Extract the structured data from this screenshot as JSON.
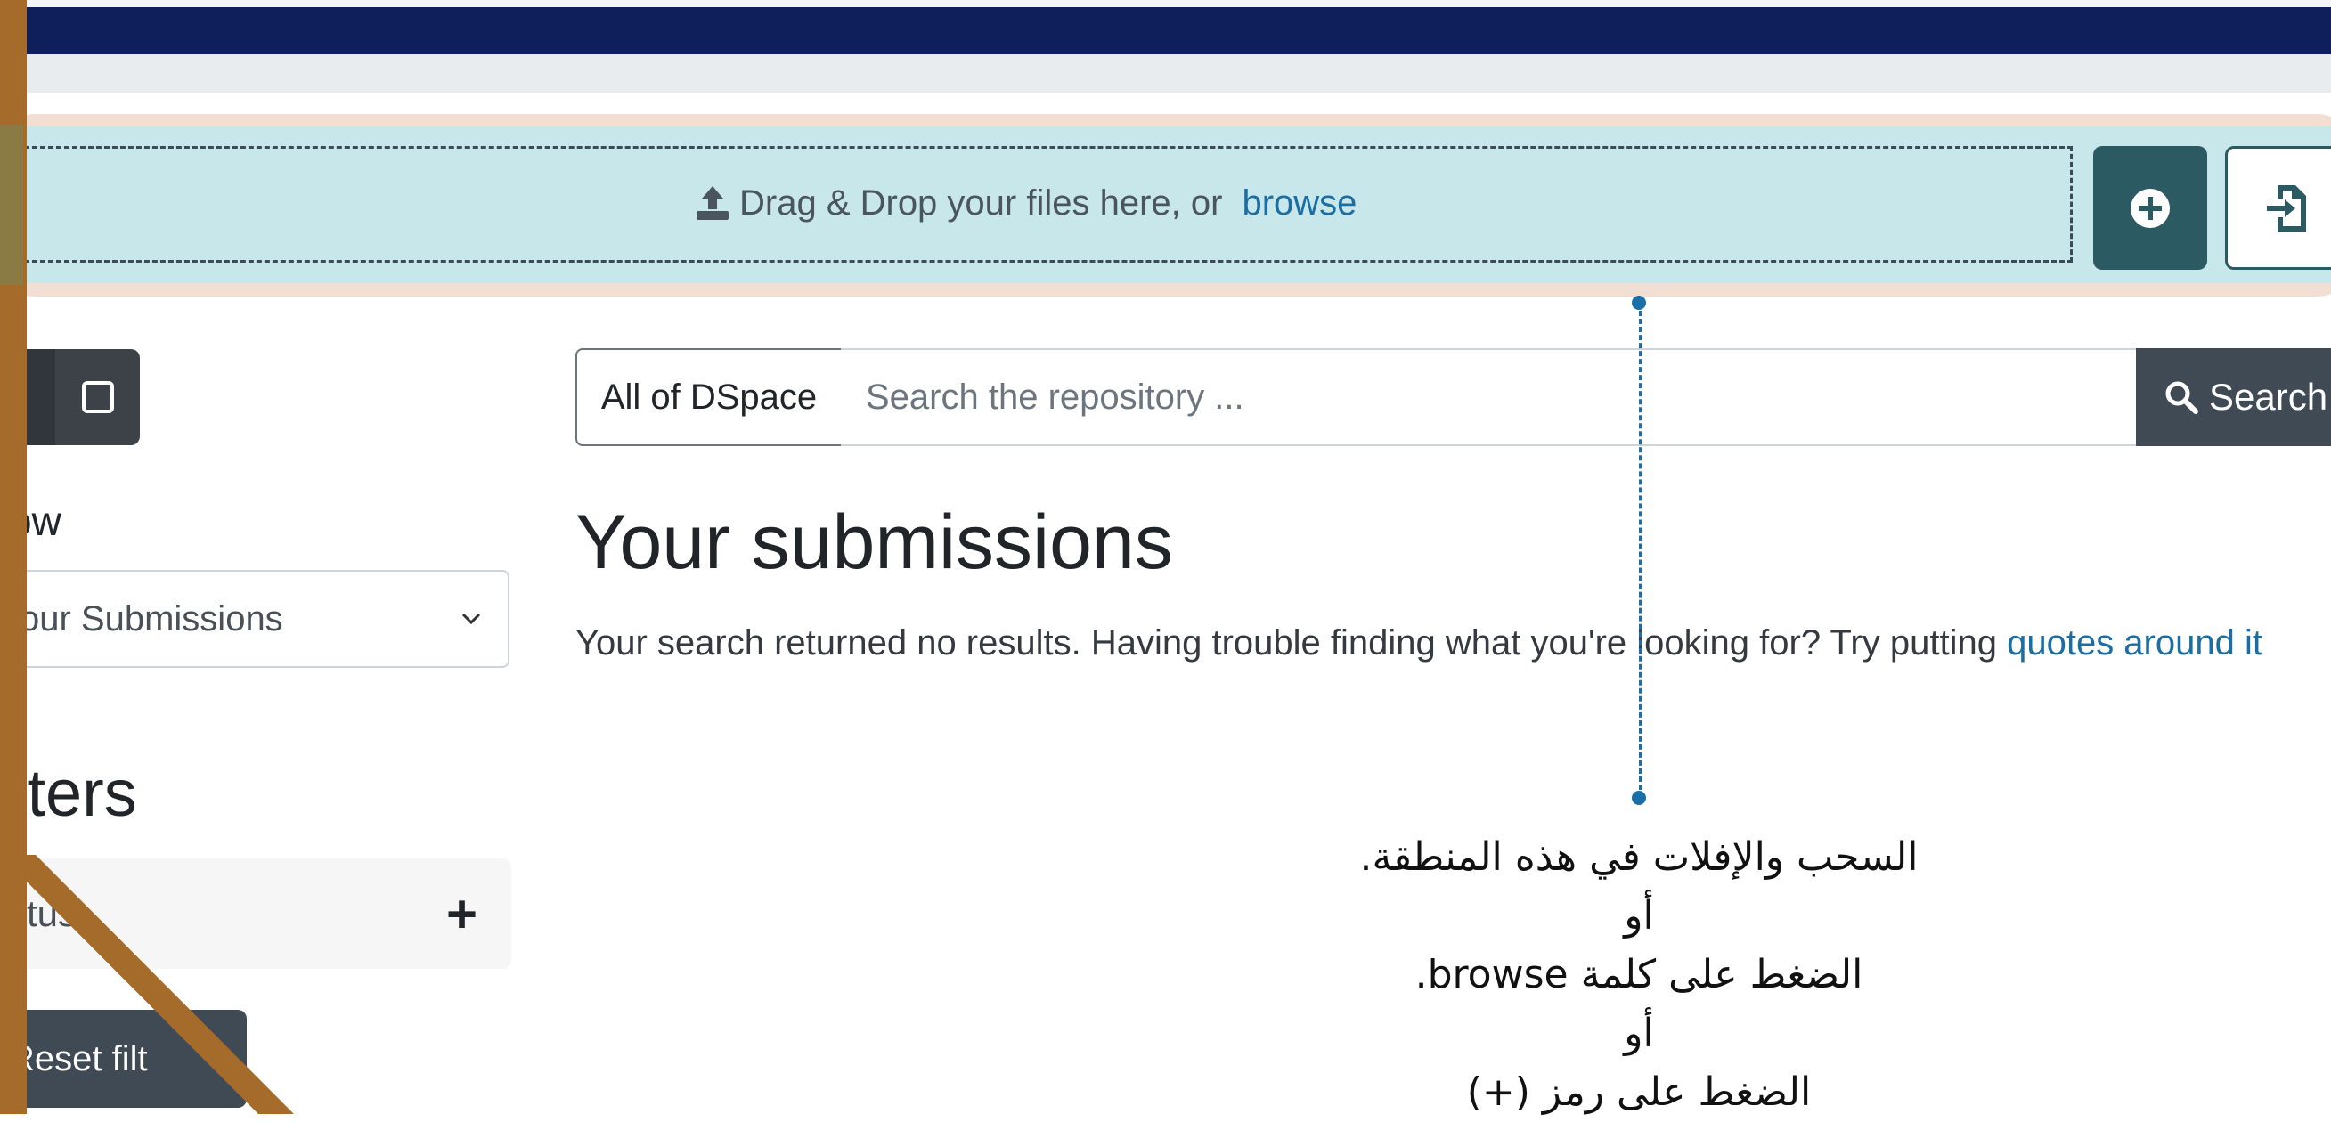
{
  "dropzone": {
    "text": "Drag & Drop your files here, or",
    "browse_link": "browse",
    "icons": {
      "upload": "upload-icon",
      "add": "plus-circle-icon",
      "import": "file-import-icon"
    }
  },
  "sidebar": {
    "view_toggle": {
      "list_icon": "list-icon",
      "grid_icon": "grid-icon"
    },
    "show_label": "ow",
    "show_select_value": "our Submissions",
    "filters_heading": "lters",
    "status_filter_label": "tus",
    "status_filter_icon": "+",
    "reset_button_label": "Reset filt"
  },
  "search": {
    "scope_label": "All of DSpace",
    "placeholder": "Search the repository ...",
    "button_label": "Search",
    "button_icon": "search-icon"
  },
  "main": {
    "title": "Your submissions",
    "no_results_text": "Your search returned no results. Having trouble finding what you're looking for? Try putting",
    "no_results_link": "quotes around it"
  },
  "annotation": {
    "lines": [
      "السحب والإفلات في هذه المنطقة.",
      "أو",
      "الضغط على كلمة browse.",
      "أو",
      "الضغط على رمز (+)"
    ]
  },
  "colors": {
    "navbar": "#0e1f5b",
    "dropzone": "#c8e7ea",
    "accent_teal": "#2c5a62",
    "link": "#1b6ea3",
    "frame": "#a46b2a"
  }
}
